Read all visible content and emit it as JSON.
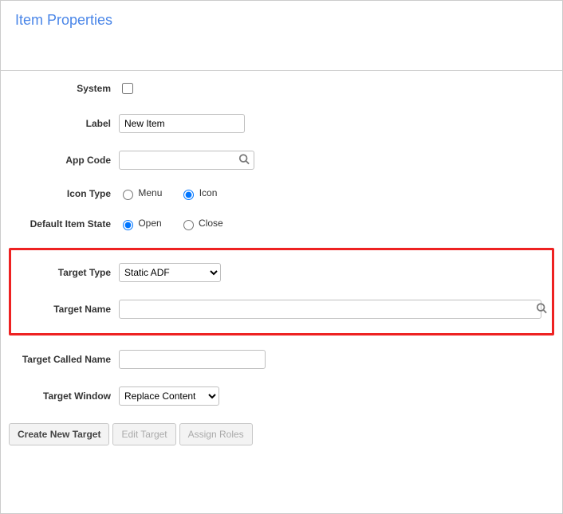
{
  "header": {
    "title": "Item Properties"
  },
  "fields": {
    "system": {
      "label": "System",
      "checked": false
    },
    "labelField": {
      "label": "Label",
      "value": "New Item"
    },
    "appCode": {
      "label": "App Code",
      "value": ""
    },
    "iconType": {
      "label": "Icon Type",
      "options": {
        "menu": "Menu",
        "icon": "Icon"
      },
      "selected": "icon"
    },
    "defaultItemState": {
      "label": "Default Item State",
      "options": {
        "open": "Open",
        "close": "Close"
      },
      "selected": "open"
    },
    "targetType": {
      "label": "Target Type",
      "options": [
        "Static ADF"
      ],
      "selected": "Static ADF"
    },
    "targetName": {
      "label": "Target Name",
      "value": ""
    },
    "targetCalledName": {
      "label": "Target Called Name",
      "value": ""
    },
    "targetWindow": {
      "label": "Target Window",
      "options": [
        "Replace Content"
      ],
      "selected": "Replace Content"
    }
  },
  "buttons": {
    "createNewTarget": "Create New Target",
    "editTarget": "Edit Target",
    "assignRoles": "Assign Roles"
  }
}
